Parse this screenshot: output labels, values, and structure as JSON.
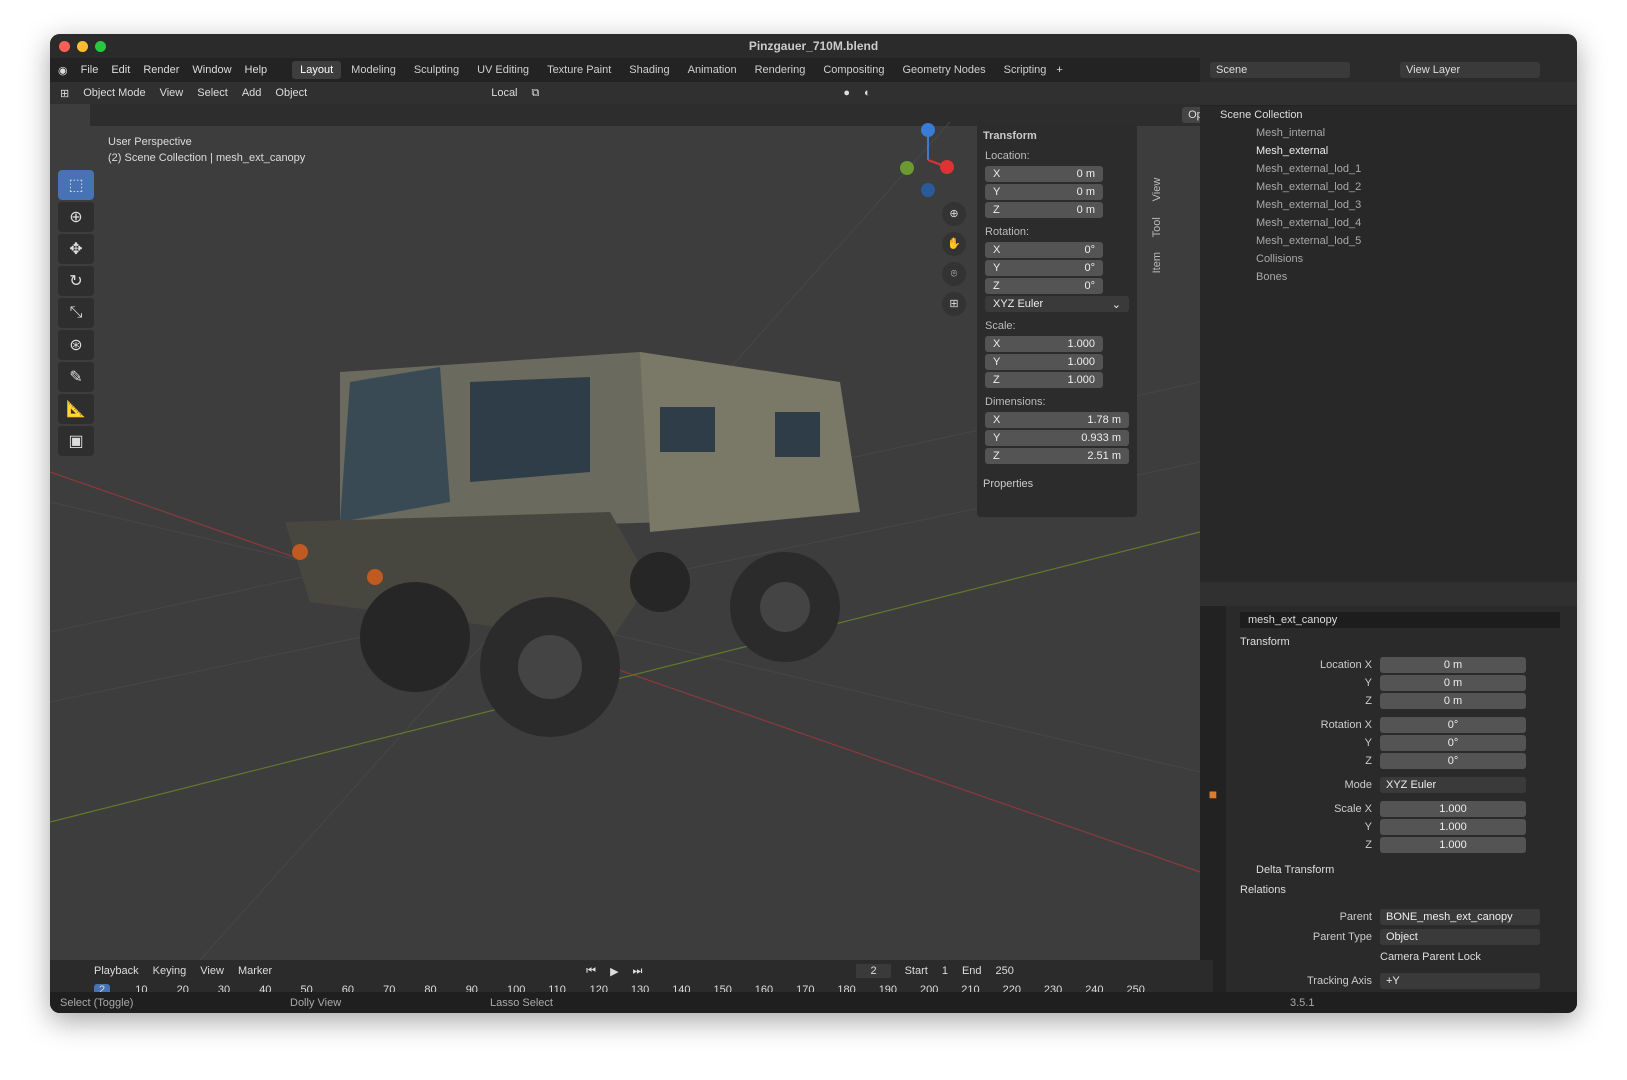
{
  "title": "Pinzgauer_710M.blend",
  "menu": [
    "File",
    "Edit",
    "Render",
    "Window",
    "Help"
  ],
  "workspaces": [
    "Layout",
    "Modeling",
    "Sculpting",
    "UV Editing",
    "Texture Paint",
    "Shading",
    "Animation",
    "Rendering",
    "Compositing",
    "Geometry Nodes",
    "Scripting"
  ],
  "viewport": {
    "mode": "Object Mode",
    "menus": [
      "View",
      "Select",
      "Add",
      "Object"
    ],
    "pivot": "Local",
    "options": "Options",
    "overlay1": "User Perspective",
    "overlay2": "(2) Scene Collection | mesh_ext_canopy"
  },
  "npanel": {
    "header": "Transform",
    "location_label": "Location:",
    "location": [
      "0 m",
      "0 m",
      "0 m"
    ],
    "rotation_label": "Rotation:",
    "rotation": [
      "0°",
      "0°",
      "0°"
    ],
    "rot_mode": "XYZ Euler",
    "scale_label": "Scale:",
    "scale": [
      "1.000",
      "1.000",
      "1.000"
    ],
    "dims_label": "Dimensions:",
    "dims": [
      "1.78 m",
      "0.933 m",
      "2.51 m"
    ],
    "properties": "Properties",
    "axes": [
      "X",
      "Y",
      "Z"
    ],
    "tabs": [
      "Item",
      "Tool",
      "View"
    ]
  },
  "scene": {
    "scene": "Scene",
    "view_layer": "View Layer"
  },
  "outliner": {
    "root": "Scene Collection",
    "items": [
      "Mesh_internal",
      "Mesh_external",
      "Mesh_external_lod_1",
      "Mesh_external_lod_2",
      "Mesh_external_lod_3",
      "Mesh_external_lod_4",
      "Mesh_external_lod_5",
      "Collisions",
      "Bones"
    ]
  },
  "props": {
    "object": "mesh_ext_canopy",
    "transform": "Transform",
    "loc": [
      "Location X",
      "Y",
      "Z"
    ],
    "locv": [
      "0 m",
      "0 m",
      "0 m"
    ],
    "rot": [
      "Rotation X",
      "Y",
      "Z"
    ],
    "rotv": [
      "0°",
      "0°",
      "0°"
    ],
    "mode_label": "Mode",
    "mode": "XYZ Euler",
    "scale": [
      "Scale X",
      "Y",
      "Z"
    ],
    "scalev": [
      "1.000",
      "1.000",
      "1.000"
    ],
    "delta": "Delta Transform",
    "relations": "Relations",
    "parent_label": "Parent",
    "parent": "BONE_mesh_ext_canopy",
    "ptype_label": "Parent Type",
    "ptype": "Object",
    "cam_lock": "Camera Parent Lock",
    "track_label": "Tracking Axis",
    "track": "+Y"
  },
  "timeline": {
    "menus": [
      "Playback",
      "Keying",
      "View",
      "Marker"
    ],
    "frame": "2",
    "start_label": "Start",
    "start": "1",
    "end_label": "End",
    "end": "250",
    "ticks": [
      "2",
      "10",
      "20",
      "30",
      "40",
      "50",
      "60",
      "70",
      "80",
      "90",
      "100",
      "110",
      "120",
      "130",
      "140",
      "150",
      "160",
      "170",
      "180",
      "190",
      "200",
      "210",
      "220",
      "230",
      "240",
      "250"
    ]
  },
  "status": {
    "a": "Select (Toggle)",
    "b": "Dolly View",
    "c": "Lasso Select",
    "version": "3.5.1"
  }
}
